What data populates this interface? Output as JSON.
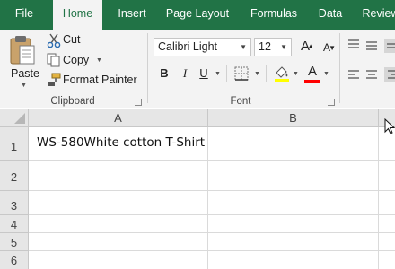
{
  "tabs": [
    "File",
    "Home",
    "Insert",
    "Page Layout",
    "Formulas",
    "Data",
    "Review"
  ],
  "active_tab": "Home",
  "clipboard": {
    "paste_label": "Paste",
    "cut_label": "Cut",
    "copy_label": "Copy",
    "format_painter_label": "Format Painter",
    "group_label": "Clipboard"
  },
  "font": {
    "font_name": "Calibri Light",
    "font_size": "12",
    "bold": "B",
    "italic": "I",
    "underline": "U",
    "font_color_letter": "A",
    "grow_letter": "A",
    "shrink_letter": "A",
    "group_label": "Font"
  },
  "colors": {
    "ribbon_green": "#217346",
    "highlight_yellow": "#ffff00",
    "font_red": "#ff0000"
  },
  "sheet": {
    "columns": [
      "A",
      "B"
    ],
    "rows": [
      "1",
      "2",
      "3",
      "4",
      "5",
      "6"
    ],
    "cell_A1": "WS-580White cotton T-Shirt"
  },
  "icons": [
    "paste-icon",
    "cut-icon",
    "copy-icon",
    "format-painter-icon",
    "borders-icon",
    "fill-color-icon",
    "font-color-icon",
    "align-icon",
    "mouse-cursor-icon"
  ]
}
